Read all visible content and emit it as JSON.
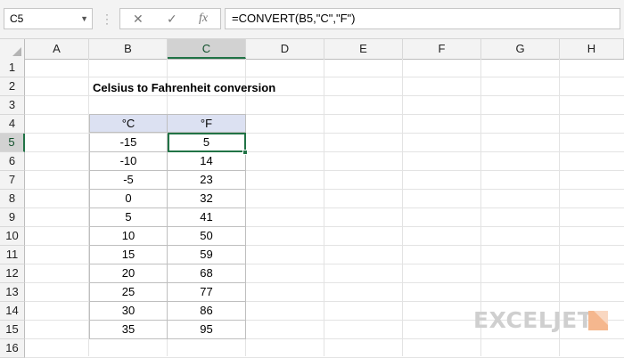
{
  "formula_bar": {
    "name_box": "C5",
    "cancel_icon": "✕",
    "enter_icon": "✓",
    "fx_label": "fx",
    "formula": "=CONVERT(B5,\"C\",\"F\")"
  },
  "columns": [
    "A",
    "B",
    "C",
    "D",
    "E",
    "F",
    "G",
    "H"
  ],
  "rows": [
    "1",
    "2",
    "3",
    "4",
    "5",
    "6",
    "7",
    "8",
    "9",
    "10",
    "11",
    "12",
    "13",
    "14",
    "15",
    "16"
  ],
  "sheet": {
    "title": "Celsius to Fahrenheit conversion",
    "table": {
      "headers": [
        "°C",
        "°F"
      ],
      "rows": [
        [
          "-15",
          "5"
        ],
        [
          "-10",
          "14"
        ],
        [
          "-5",
          "23"
        ],
        [
          "0",
          "32"
        ],
        [
          "5",
          "41"
        ],
        [
          "10",
          "50"
        ],
        [
          "15",
          "59"
        ],
        [
          "20",
          "68"
        ],
        [
          "25",
          "77"
        ],
        [
          "30",
          "86"
        ],
        [
          "35",
          "95"
        ]
      ]
    }
  },
  "logo": {
    "text": "EXCELJET"
  },
  "colors": {
    "accent": "#217346",
    "table_header": "#dce1f2",
    "logo": "#cfcfcf",
    "logo_mark": "#f5b78e"
  }
}
